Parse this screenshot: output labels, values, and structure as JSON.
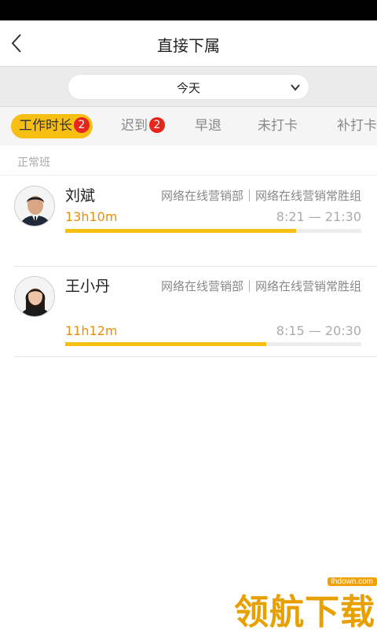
{
  "header": {
    "title": "直接下属",
    "back_icon": "chevron-left-icon"
  },
  "date_filter": {
    "selected": "今天",
    "icon": "chevron-down-icon"
  },
  "tabs": [
    {
      "label": "工作时长",
      "badge": "2",
      "active": true
    },
    {
      "label": "迟到",
      "badge": "2",
      "active": false
    },
    {
      "label": "早退",
      "active": false
    },
    {
      "label": "未打卡",
      "active": false
    },
    {
      "label": "补打卡",
      "active": false
    }
  ],
  "section": {
    "title": "正常班"
  },
  "employees": [
    {
      "name": "刘斌",
      "department": "网络在线营销部｜网络在线营销常胜组",
      "duration": "13h10m",
      "time_range": "8:21 — 21:30",
      "progress": 0.78
    },
    {
      "name": "王小丹",
      "department": "网络在线营销部｜网络在线营销常胜组",
      "duration": "11h12m",
      "time_range": "8:15 — 20:30",
      "progress": 0.68
    }
  ],
  "watermark": {
    "text": "领航下载",
    "url": "lhdown.com"
  },
  "colors": {
    "accent": "#f6bf11",
    "badge": "#e5261b",
    "duration": "#f08c00",
    "statusbar": "#000000"
  }
}
